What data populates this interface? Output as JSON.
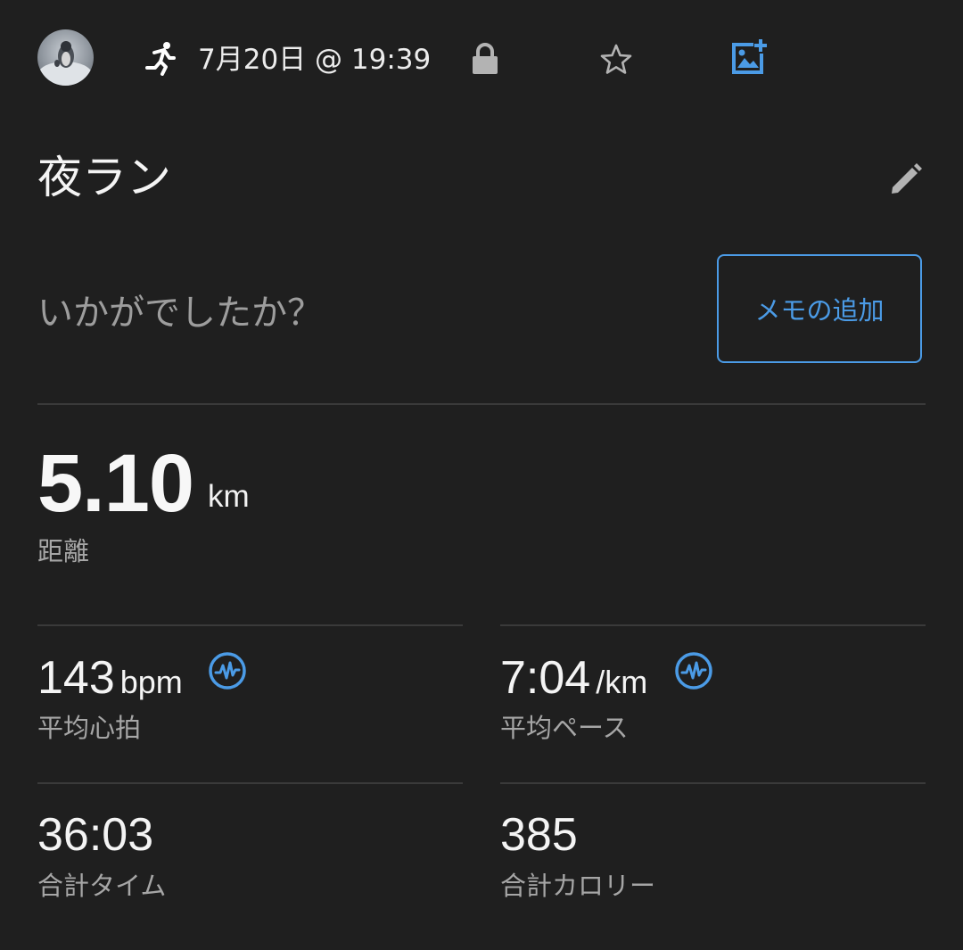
{
  "header": {
    "avatar_name": "avatar",
    "activity_icon": "running-icon",
    "datetime": "7月20日 @ 19:39",
    "privacy_icon": "lock-icon",
    "favorite_icon": "star-icon",
    "add_photo_icon": "add-photo-icon"
  },
  "activity": {
    "title": "夜ラン",
    "edit_icon": "pencil-icon"
  },
  "memo": {
    "prompt": "いかがでしたか？",
    "button_label": "メモの追加"
  },
  "distance": {
    "value": "5.10",
    "unit": "km",
    "label": "距離"
  },
  "stats": [
    {
      "value": "143",
      "unit": "bpm",
      "label": "平均心拍",
      "icon": "heart-rate-icon"
    },
    {
      "value": "7:04",
      "unit": "/km",
      "label": "平均ペース",
      "icon": "heart-rate-icon"
    },
    {
      "value": "36:03",
      "unit": "",
      "label": "合計タイム"
    },
    {
      "value": "385",
      "unit": "",
      "label": "合計カロリー"
    }
  ],
  "colors": {
    "background": "#1f1f1f",
    "accent": "#4b9be6",
    "text_primary": "#f4f4f4",
    "text_secondary": "#a6a6a6",
    "divider": "#3a3a3a"
  }
}
